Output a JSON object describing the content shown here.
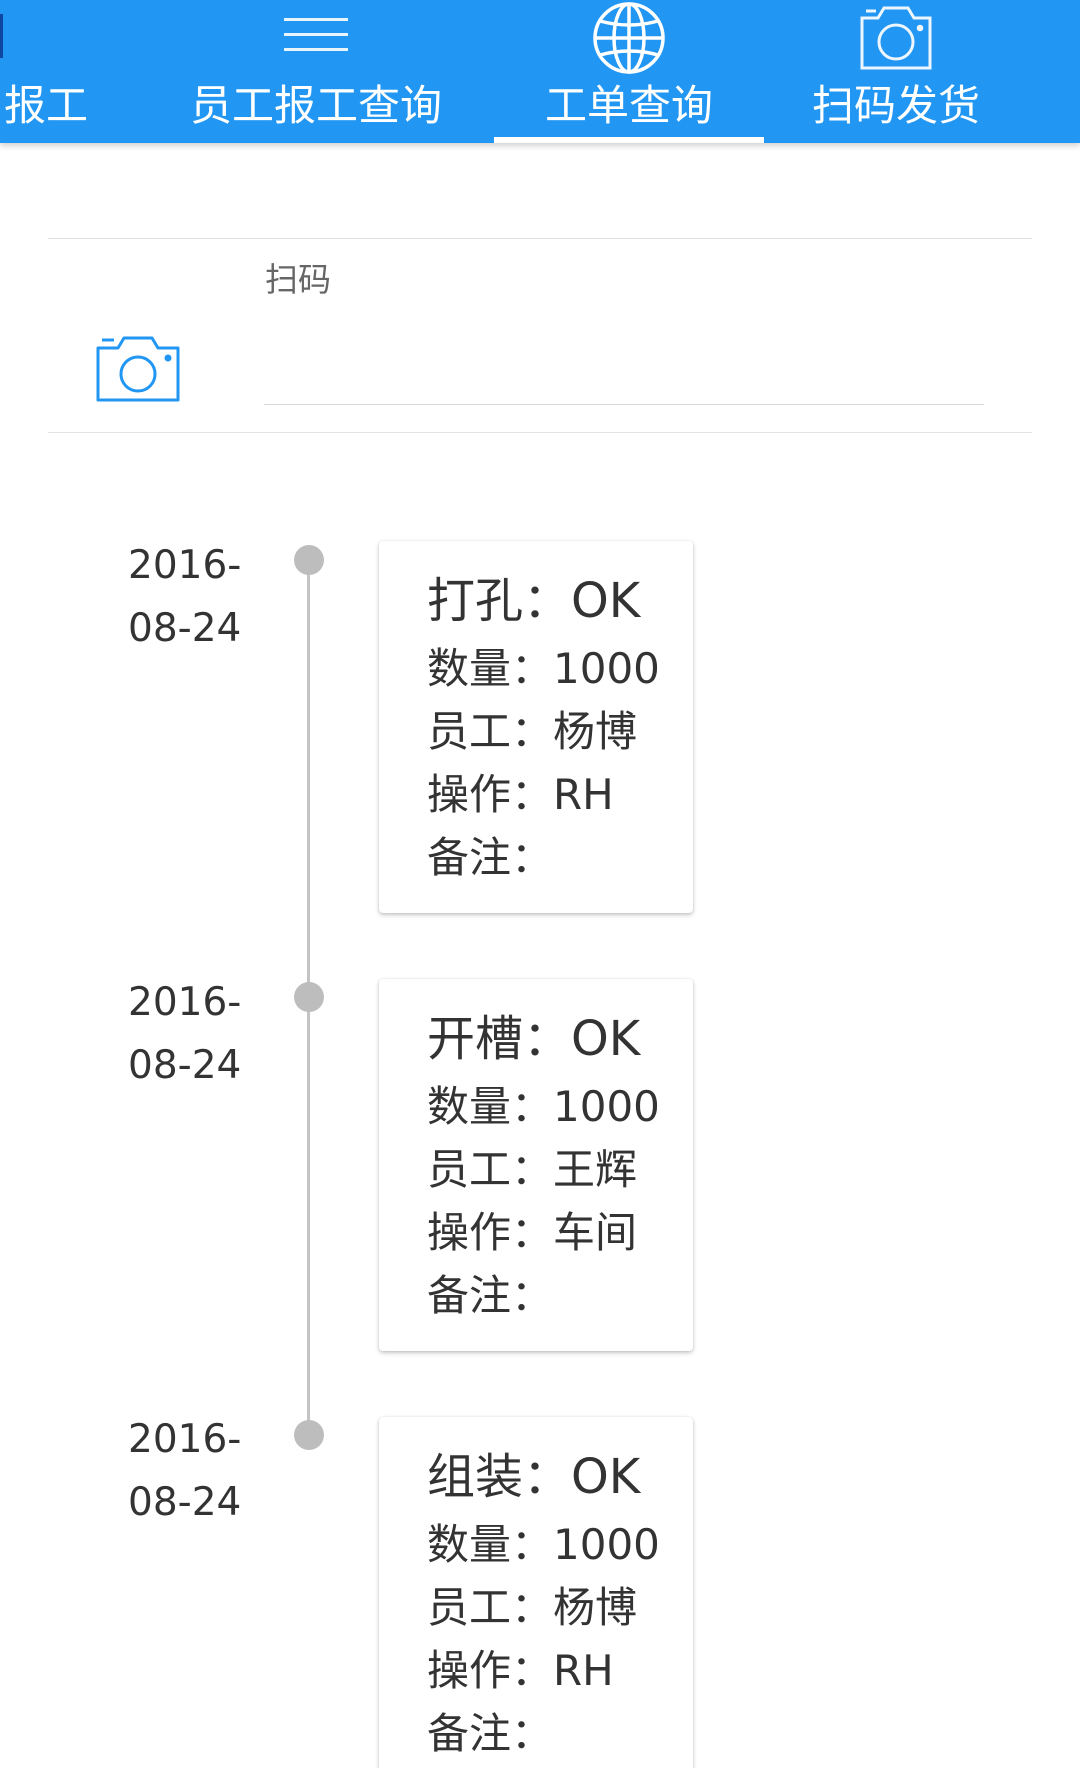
{
  "tabs": [
    {
      "label": "报工",
      "icon": "none"
    },
    {
      "label": "员工报工查询",
      "icon": "menu-icon"
    },
    {
      "label": "工单查询",
      "icon": "globe-icon",
      "active": true
    },
    {
      "label": "扫码发货",
      "icon": "camera-icon"
    }
  ],
  "scan": {
    "label": "扫码",
    "value": "",
    "icon": "camera-icon"
  },
  "timeline": [
    {
      "date": "2016-08-24",
      "title": "打孔：OK",
      "quantity": "数量：1000",
      "employee": "员工：杨博",
      "operation": "操作：RH",
      "remark": "备注："
    },
    {
      "date": "2016-08-24",
      "title": "开槽：OK",
      "quantity": "数量：1000",
      "employee": "员工：王辉",
      "operation": "操作：车间",
      "remark": "备注："
    },
    {
      "date": "2016-08-24",
      "title": "组装：OK",
      "quantity": "数量：1000",
      "employee": "员工：杨博",
      "operation": "操作：RH",
      "remark": "备注："
    }
  ],
  "colors": {
    "primary": "#2196f3",
    "text": "#333333",
    "icon_accent": "#2196f3",
    "timeline_dot": "#bdbdbd"
  }
}
